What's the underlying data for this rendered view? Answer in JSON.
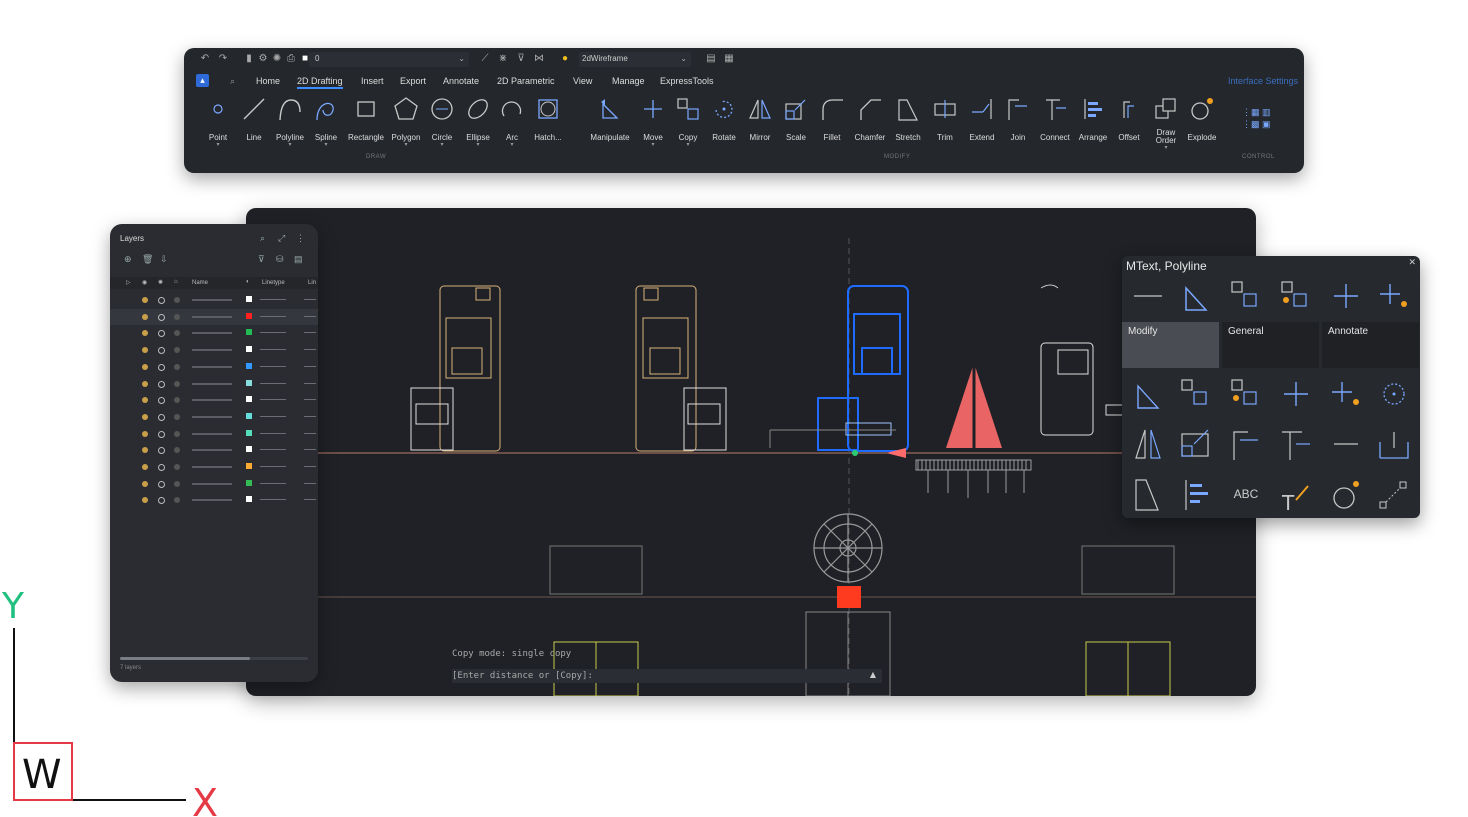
{
  "ribbon": {
    "layer_combo_value": "0",
    "visual_style": "2dWireframe",
    "tabs": [
      "Home",
      "2D Drafting",
      "Insert",
      "Export",
      "Annotate",
      "2D Parametric",
      "View",
      "Manage",
      "ExpressTools"
    ],
    "active_tab": "2D Drafting",
    "interface_link": "Interface Settings",
    "groups": {
      "draw": "DRAW",
      "modify": "MODIFY",
      "control": "CONTROL"
    },
    "draw_tools": [
      "Point",
      "Line",
      "Polyline",
      "Spline",
      "Rectangle",
      "Polygon",
      "Circle",
      "Ellipse",
      "Arc",
      "Hatch..."
    ],
    "modify_tools": [
      "Manipulate",
      "Move",
      "Copy",
      "Rotate",
      "Mirror",
      "Scale",
      "Fillet",
      "Chamfer",
      "Stretch",
      "Trim",
      "Extend",
      "Join",
      "Connect",
      "Arrange",
      "Offset",
      "Draw Order",
      "Explode"
    ]
  },
  "canvas": {
    "cmd_history": "Copy mode: single copy",
    "cmd_prompt": "[Enter distance or [Copy]:",
    "colors": {
      "selected": "#1e6cff",
      "background": "#1f2126",
      "marker_red": "#ff3b1f",
      "triangle": "#ff6b6b"
    }
  },
  "layers": {
    "title": "Layers",
    "columns": {
      "name": "Name",
      "linetype": "Linetype",
      "lw": "Lin"
    },
    "rows": [
      {
        "color": "#ffffff",
        "selected": false
      },
      {
        "color": "#ff2020",
        "selected": true
      },
      {
        "color": "#22bb55",
        "selected": false
      },
      {
        "color": "#ffffff",
        "selected": false
      },
      {
        "color": "#3399ff",
        "selected": false
      },
      {
        "color": "#88dddd",
        "selected": false
      },
      {
        "color": "#ffffff",
        "selected": false
      },
      {
        "color": "#66dddd",
        "selected": false
      },
      {
        "color": "#55ddbb",
        "selected": false
      },
      {
        "color": "#ffffff",
        "selected": false
      },
      {
        "color": "#ffaa33",
        "selected": false
      },
      {
        "color": "#33bb55",
        "selected": false
      },
      {
        "color": "#ffffff",
        "selected": false
      }
    ],
    "count": "7 layers"
  },
  "quad": {
    "title": "MText, Polyline",
    "tabs": [
      "Modify",
      "General",
      "Annotate"
    ],
    "active_tab": "Modify"
  },
  "ucs": {
    "x_label": "X",
    "y_label": "Y",
    "w_label": "W"
  }
}
